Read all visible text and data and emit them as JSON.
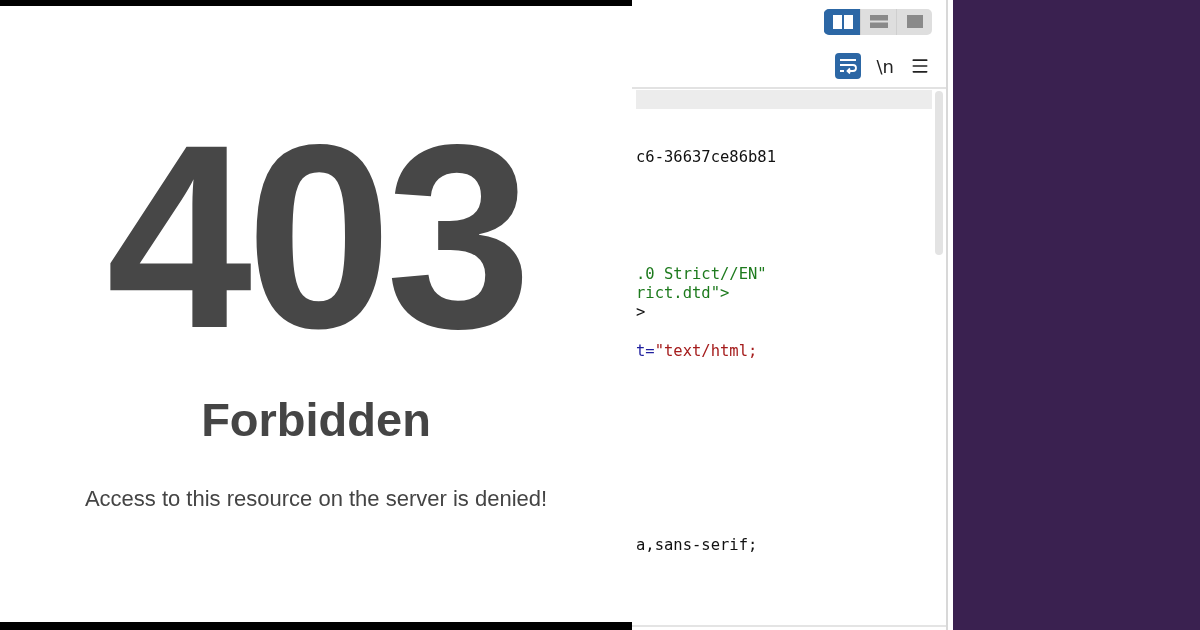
{
  "preview": {
    "code": "403",
    "title": "Forbidden",
    "message": "Access to this resource on the server is denied!"
  },
  "toolbar": {
    "layouts": [
      {
        "kind": "columns",
        "selected": true
      },
      {
        "kind": "rows",
        "selected": false
      },
      {
        "kind": "single",
        "selected": false
      }
    ],
    "wrap": {
      "on": true
    },
    "newline_toggle": "\\n"
  },
  "code_lines": [
    {
      "kind": "current",
      "highlighted": true
    },
    {
      "kind": "blank"
    },
    {
      "kind": "blank"
    },
    {
      "kind": "text",
      "highlighted": false,
      "segments": [
        {
          "kind": "plain",
          "text": "c6-36637ce86b81"
        }
      ]
    },
    {
      "kind": "blank"
    },
    {
      "kind": "blank"
    },
    {
      "kind": "blank"
    },
    {
      "kind": "blank"
    },
    {
      "kind": "blank"
    },
    {
      "kind": "text",
      "highlighted": false,
      "segments": [
        {
          "kind": "string",
          "text": ".0 Strict//EN\""
        }
      ]
    },
    {
      "kind": "text",
      "highlighted": false,
      "segments": [
        {
          "kind": "string",
          "text": "rict.dtd\">"
        }
      ]
    },
    {
      "kind": "text",
      "highlighted": false,
      "segments": [
        {
          "kind": "plain",
          "text": ">"
        }
      ]
    },
    {
      "kind": "blank"
    },
    {
      "kind": "text",
      "highlighted": false,
      "segments": [
        {
          "kind": "attr",
          "text": "t="
        },
        {
          "kind": "value",
          "text": "\"text/html;"
        }
      ]
    },
    {
      "kind": "blank"
    },
    {
      "kind": "blank"
    },
    {
      "kind": "blank"
    },
    {
      "kind": "blank"
    },
    {
      "kind": "blank"
    },
    {
      "kind": "blank"
    },
    {
      "kind": "blank"
    },
    {
      "kind": "blank"
    },
    {
      "kind": "blank"
    },
    {
      "kind": "text",
      "highlighted": false,
      "segments": [
        {
          "kind": "plain",
          "text": "a,sans-serif;"
        }
      ]
    }
  ]
}
